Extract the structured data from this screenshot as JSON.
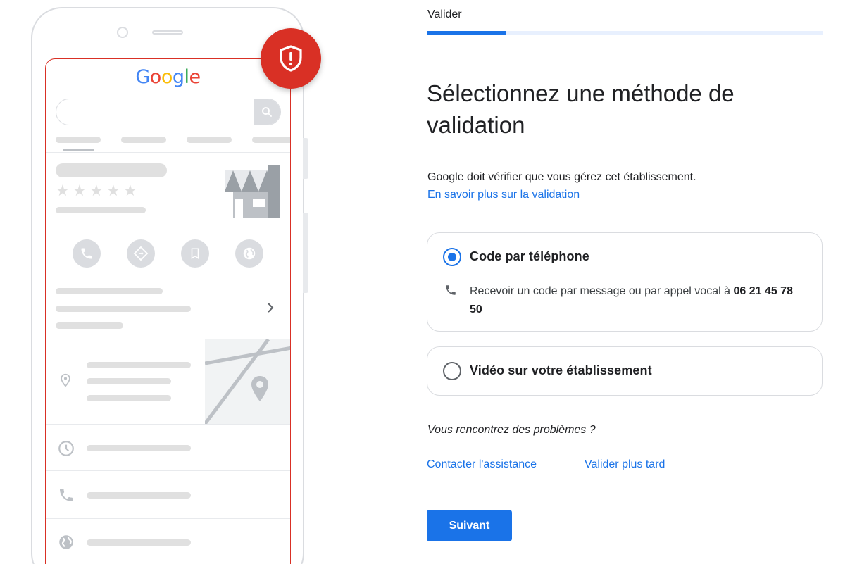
{
  "illustration": {
    "logo_letters": [
      "G",
      "o",
      "o",
      "g",
      "l",
      "e"
    ],
    "logo_colors": [
      "#4285F4",
      "#EA4335",
      "#FBBC05",
      "#4285F4",
      "#34A853",
      "#EA4335"
    ],
    "stars": [
      "★",
      "★",
      "★",
      "★",
      "★"
    ],
    "action_icons": [
      "phone-icon",
      "directions-icon",
      "bookmark-icon",
      "globe-icon"
    ],
    "list_icons": [
      "location-pin-icon",
      "clock-icon",
      "phone-icon",
      "globe-icon"
    ],
    "badge_icon": "shield-alert-icon"
  },
  "header": {
    "step_label": "Valider",
    "progress_fraction": 0.2
  },
  "main": {
    "title": "Sélectionnez une méthode de validation",
    "description": "Google doit vérifier que vous gérez cet établissement.",
    "learn_more_link": "En savoir plus sur la validation"
  },
  "options": [
    {
      "label": "Code par téléphone",
      "selected": true,
      "detail_prefix": "Recevoir un code par message ou par appel vocal à ",
      "detail_number": "06 21 45 78 50"
    },
    {
      "label": "Vidéo sur votre établissement",
      "selected": false
    }
  ],
  "footer": {
    "problems_text": "Vous rencontrez des problèmes ?",
    "contact_link": "Contacter l'assistance",
    "later_link": "Valider plus tard",
    "next_button": "Suivant"
  },
  "colors": {
    "accent": "#1a73e8",
    "alert": "#d93025",
    "border": "#dadce0"
  }
}
